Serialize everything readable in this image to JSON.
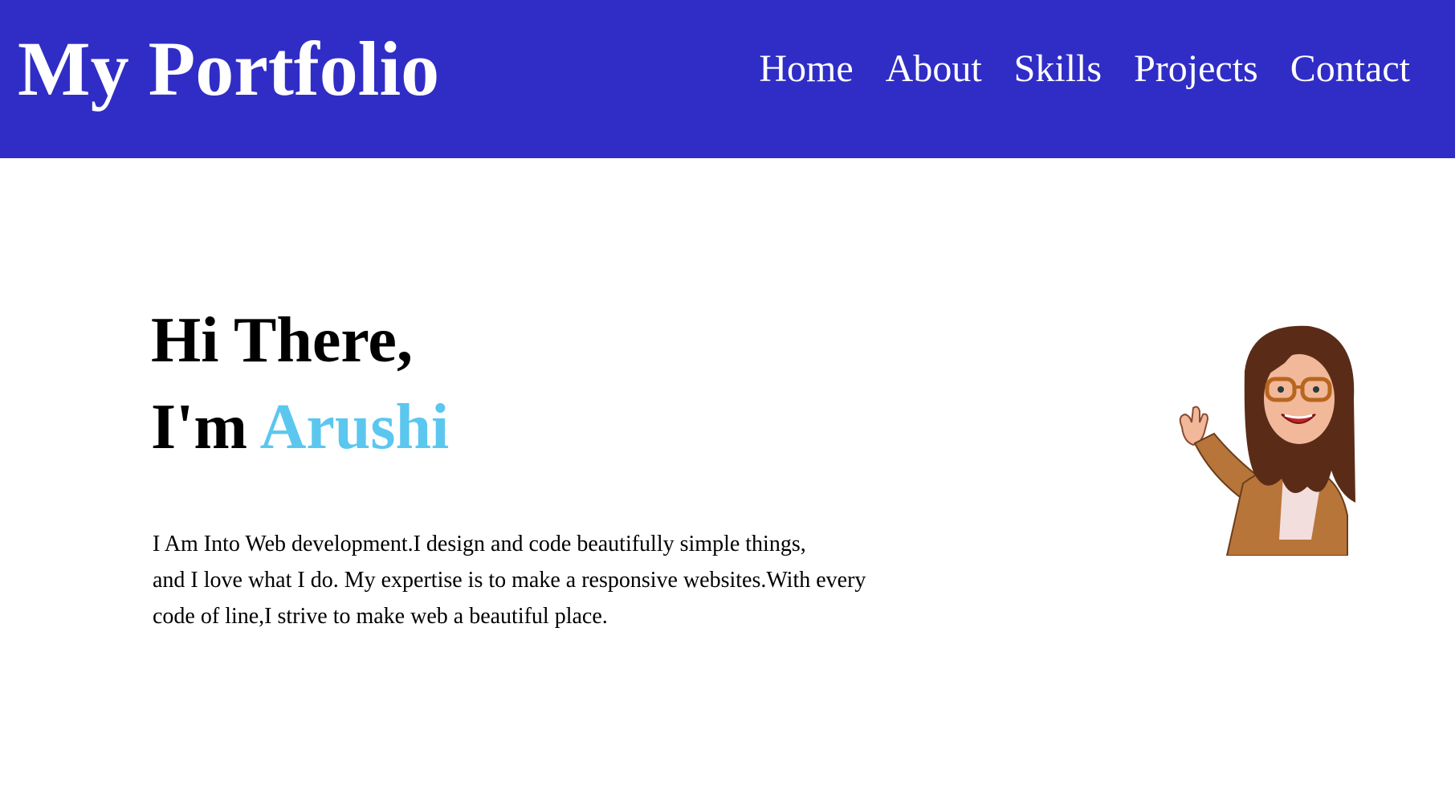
{
  "header": {
    "brand": "My Portfolio",
    "nav": [
      {
        "label": "Home"
      },
      {
        "label": "About"
      },
      {
        "label": "Skills"
      },
      {
        "label": "Projects"
      },
      {
        "label": "Contact"
      }
    ]
  },
  "hero": {
    "greeting": "Hi There,",
    "intro_prefix": "I'm",
    "name": "Arushi",
    "description_lines": [
      "I Am Into Web development.I design and code beautifully simple things,",
      "and I love what I do. My expertise is to make a responsive websites.With every",
      "code of line,I strive to make web a beautiful place."
    ],
    "avatar_icon": "waving-bitmoji-avatar"
  },
  "colors": {
    "navbar": "#302dc6",
    "accent": "#5bc7ef",
    "text": "#000000"
  }
}
